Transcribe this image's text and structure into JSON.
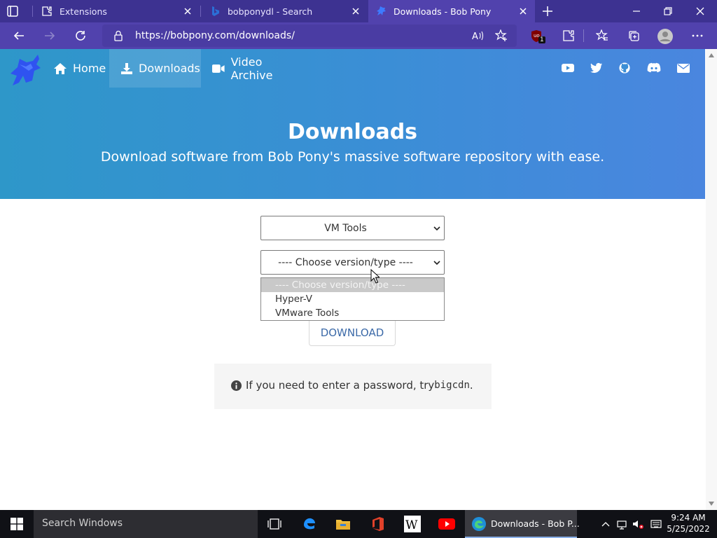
{
  "browser": {
    "tabs": [
      {
        "title": "Extensions",
        "active": false
      },
      {
        "title": "bobponydl - Search",
        "active": false
      },
      {
        "title": "Downloads - Bob Pony",
        "active": true
      }
    ],
    "url": "https://bobpony.com/downloads/",
    "extension_badge": "1"
  },
  "site": {
    "nav": {
      "home": "Home",
      "downloads": "Downloads",
      "video_archive": "Video Archive"
    },
    "social_icons": [
      "youtube-icon",
      "twitter-icon",
      "github-icon",
      "discord-icon",
      "mail-icon"
    ],
    "hero": {
      "title": "Downloads",
      "subtitle": "Download software from Bob Pony's massive software repository with ease."
    },
    "category_select": {
      "value": "VM Tools"
    },
    "version_select": {
      "value": "---- Choose version/type ----",
      "options": [
        "---- Choose version/type ----",
        "Hyper-V",
        "VMware Tools"
      ]
    },
    "download_button": "DOWNLOAD",
    "note": {
      "prefix": "If you need to enter a password, try ",
      "code": "bigcdn",
      "suffix": "."
    }
  },
  "taskbar": {
    "search_placeholder": "Search Windows",
    "active_app": "Downloads - Bob P...",
    "time": "9:24 AM",
    "date": "5/25/2022"
  },
  "colors": {
    "tabbar": "#3d3291",
    "toolbar": "#5142ad",
    "hero_start": "#2e97c9",
    "hero_end": "#4a86df",
    "link": "#3c6aa8"
  }
}
